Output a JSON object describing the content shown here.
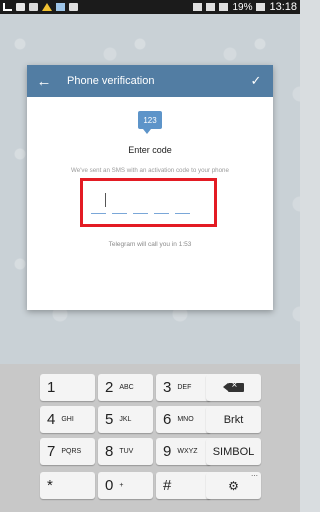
{
  "status_bar": {
    "battery": "19%",
    "time": "13:18"
  },
  "dialog": {
    "title": "Phone verification",
    "back_icon": "arrow-left-icon",
    "confirm_icon": "checkmark-icon",
    "bubble_text": "123",
    "heading": "Enter code",
    "sms_message": "We've sent an SMS with an activation code to your phone",
    "call_message": "Telegram will call you in 1:53"
  },
  "colors": {
    "header": "#527da3",
    "highlight_border": "#e31b23",
    "digit_underline": "#7aa7d8"
  },
  "keyboard": {
    "keys": [
      {
        "num": "1",
        "sub": ""
      },
      {
        "num": "2",
        "sub": "ABC"
      },
      {
        "num": "3",
        "sub": "DEF"
      },
      {
        "num": "4",
        "sub": "GHI"
      },
      {
        "num": "5",
        "sub": "JKL"
      },
      {
        "num": "6",
        "sub": "MNO"
      },
      {
        "num": "7",
        "sub": "PQRS"
      },
      {
        "num": "8",
        "sub": "TUV"
      },
      {
        "num": "9",
        "sub": "WXYZ"
      },
      {
        "num": "*",
        "sub": ""
      },
      {
        "num": "0",
        "sub": "+"
      },
      {
        "num": "#",
        "sub": ""
      }
    ],
    "backspace_icon": "backspace-icon",
    "next_label": "Brkt",
    "symbol_label": "SIMBOL",
    "settings_icon": "gear-icon"
  }
}
